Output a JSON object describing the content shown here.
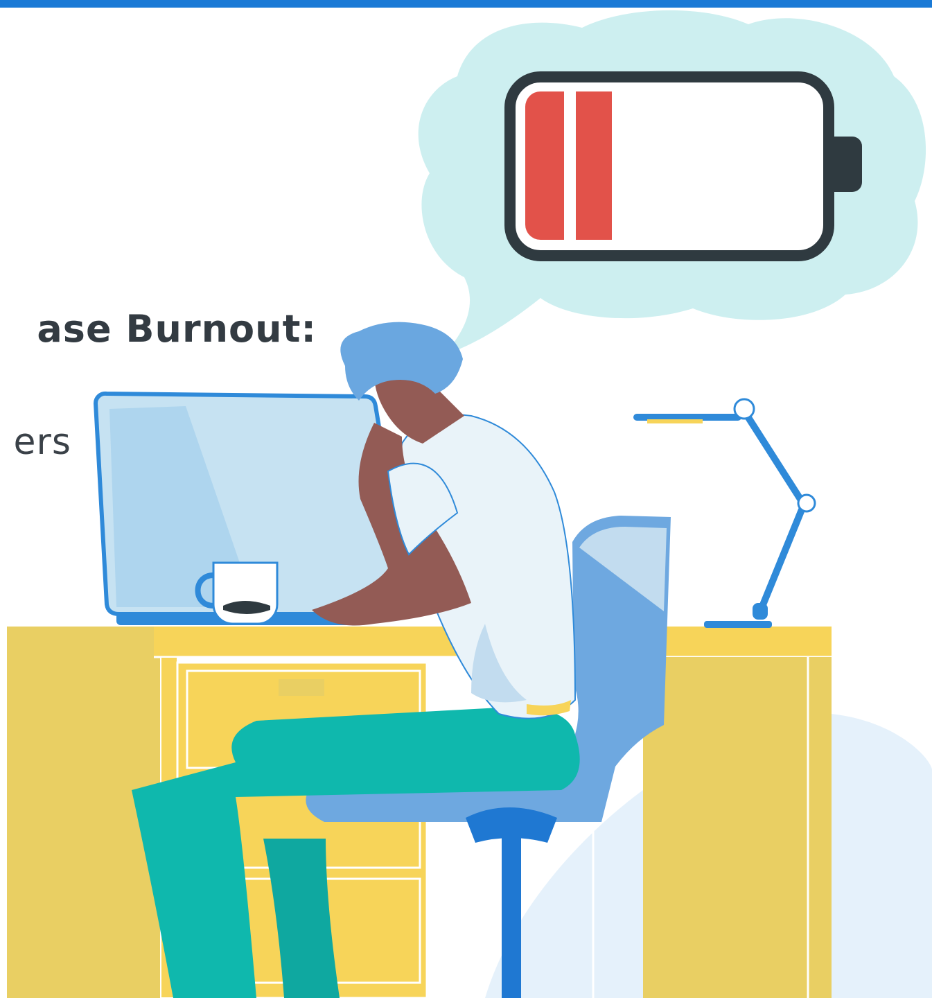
{
  "slide": {
    "title_fragment": "ase Burnout:",
    "subtitle_fragment": "ers"
  },
  "battery": {
    "charge_level": 0.12,
    "charge_bars_filled": 2
  },
  "colors": {
    "top_bar": "#1a7ad6",
    "text": "#333b42",
    "text_light": "#3a4148",
    "cloud": "#cdeff0",
    "battery_outline": "#2f3a40",
    "battery_low": "#e2524a",
    "desk": "#f7d459",
    "desk_side": "#e9cf63",
    "skin": "#935b55",
    "hair": "#6aa7e0",
    "shirt": "#e9f3f9",
    "pants": "#0fb8ad",
    "chair": "#6ea8e0",
    "chair_base": "#1f78d2",
    "laptop": "#c6e2f2",
    "floor_bg": "#e5f1fb"
  },
  "icons": {
    "battery": "battery-low-icon",
    "thought_cloud": "thought-bubble-icon",
    "lamp": "desk-lamp-icon",
    "mug": "coffee-mug-icon",
    "laptop": "laptop-icon"
  }
}
